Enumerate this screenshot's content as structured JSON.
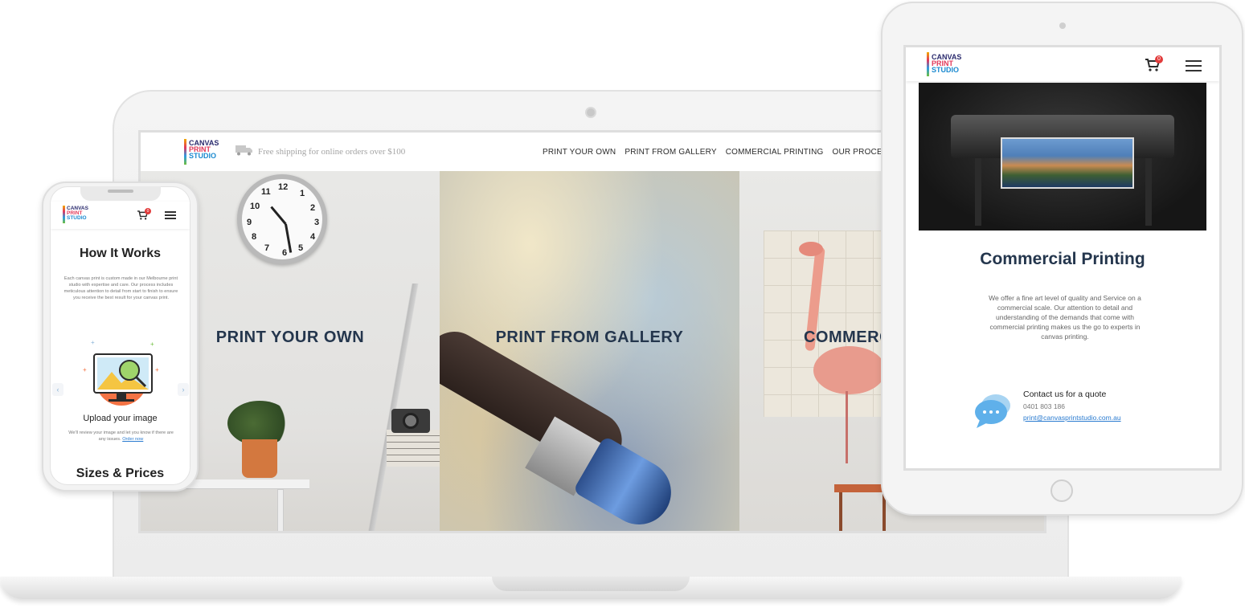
{
  "laptop": {
    "logo": [
      "CANVAS",
      "PRINT",
      "STUDIO"
    ],
    "shipping_text": "Free shipping for online orders over $100",
    "nav": [
      "PRINT YOUR OWN",
      "PRINT FROM GALLERY",
      "COMMERCIAL PRINTING",
      "OUR PROCE"
    ],
    "panels": [
      "PRINT YOUR OWN",
      "PRINT FROM GALLERY",
      "COMMERC"
    ],
    "clock_numbers": [
      "12",
      "1",
      "2",
      "3",
      "4",
      "5",
      "6",
      "7",
      "8",
      "9",
      "10",
      "11"
    ]
  },
  "tablet": {
    "logo": [
      "CANVAS",
      "PRINT",
      "STUDIO"
    ],
    "cart_count": "0",
    "title": "Commercial Printing",
    "description": "We offer a fine art level of quality and Service on a commercial scale. Our attention to detail and understanding of the demands that come with commercial printing makes us the go to experts in canvas printing.",
    "contact_title": "Contact us for a quote",
    "contact_phone": "0401 803 186",
    "contact_email": "print@canvasprintstudio.com.au"
  },
  "phone": {
    "logo": [
      "CANVAS",
      "PRINT",
      "STUDIO"
    ],
    "cart_count": "0",
    "title": "How It Works",
    "intro": "Each canvas print is custom made in our Melbourne print studio with expertise and care. Our process includes meticulous attention to detail from start to finish to ensure you receive the best result for your canvas print.",
    "step_title": "Upload your image",
    "step_text": "We'll review your image and let you know if there are any issues.",
    "step_link": "Order now",
    "prev_arrow": "‹",
    "next_arrow": "›",
    "sizes_title": "Sizes & Prices"
  },
  "colors": {
    "heading": "#24364d",
    "link": "#2a7bd0",
    "badge": "#e23b3b"
  }
}
